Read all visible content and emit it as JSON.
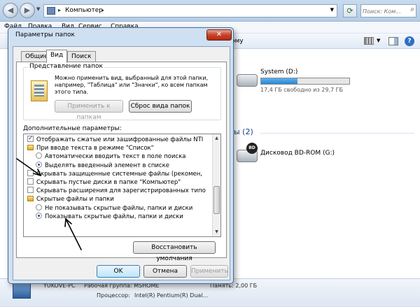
{
  "explorer": {
    "address": "Компьютер",
    "search_placeholder": "Поиск: Ком...",
    "menu": [
      "Файл",
      "Правка",
      "Вид",
      "Сервис",
      "Справка"
    ],
    "toolbar_partial_text": "ому",
    "drive_system": {
      "name": "System (D:)",
      "info": "17,4 ГБ свободно из 29,7 ГБ",
      "fill_fraction": 0.41
    },
    "group_removable_partial": "ы (2)",
    "drive_bd": {
      "name": "Дисковод BD-ROM (G:)",
      "badge": "BD"
    },
    "details": {
      "pc_name_partial": "YUKOVE-PC",
      "workgroup_partial": "Рабочая группа: MSHOME",
      "memory_partial": "Память: 2,00 ГБ",
      "processor_label": "Процессор:",
      "processor_value": "Intel(R) Pentium(R) Dual..."
    }
  },
  "dialog": {
    "title": "Параметры папок",
    "close_label": "✕",
    "tabs": [
      "Общие",
      "Вид",
      "Поиск"
    ],
    "active_tab": "Вид",
    "folder_view": {
      "label": "Представление папок",
      "description": "Можно применить вид, выбранный для этой папки, например, \"Таблица\" или \"Значки\", ко всем папкам этого типа.",
      "apply_button": "Применить к папкам",
      "reset_button": "Сброс вида папок"
    },
    "advanced_label": "Дополнительные параметры:",
    "tree": [
      {
        "kind": "checkbox",
        "checked": true,
        "indent": 0,
        "text": "Отображать сжатые или зашифрованные файлы NTI"
      },
      {
        "kind": "folder",
        "indent": 0,
        "text": "При вводе текста в режиме \"Список\""
      },
      {
        "kind": "radio",
        "checked": false,
        "indent": 1,
        "text": "Автоматически вводить текст в поле поиска"
      },
      {
        "kind": "radio",
        "checked": true,
        "indent": 1,
        "text": "Выделять введенный элемент в списке"
      },
      {
        "kind": "checkbox",
        "checked": false,
        "indent": 0,
        "text": "Скрывать защищенные системные файлы (рекомен,"
      },
      {
        "kind": "checkbox",
        "checked": false,
        "indent": 0,
        "text": "Скрывать пустые диски в папке \"Компьютер\""
      },
      {
        "kind": "checkbox",
        "checked": false,
        "indent": 0,
        "text": "Скрывать расширения для зарегистрированных типо"
      },
      {
        "kind": "folder",
        "indent": 0,
        "text": "Скрытые файлы и папки"
      },
      {
        "kind": "radio",
        "checked": false,
        "indent": 1,
        "text": "Не показывать скрытые файлы, папки и диски"
      },
      {
        "kind": "radio",
        "checked": true,
        "indent": 1,
        "text": "Показывать скрытые файлы, папки и диски"
      }
    ],
    "restore_button": "Восстановить умолчания",
    "ok_button": "OK",
    "cancel_button": "Отмена",
    "apply_button": "Применить"
  },
  "colors": {
    "accent": "#3c7fb1",
    "title_bar": "#c9dbee",
    "group_header": "#1e3f87",
    "close": "#c7432b"
  }
}
